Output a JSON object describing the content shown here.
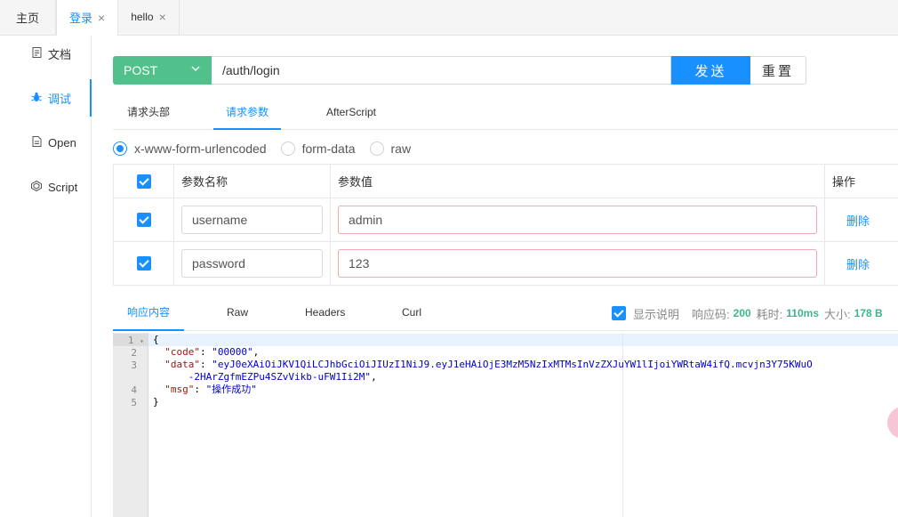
{
  "tabs": {
    "home": "主页",
    "login": "登录",
    "hello": "hello",
    "close": "×"
  },
  "sidebar": {
    "items": [
      {
        "label": "文档",
        "icon": "document-icon"
      },
      {
        "label": "调试",
        "icon": "bug-icon"
      },
      {
        "label": "Open",
        "icon": "file-icon"
      },
      {
        "label": "Script",
        "icon": "code-icon"
      }
    ]
  },
  "request": {
    "method": "POST",
    "url": "/auth/login",
    "send": "发送",
    "reset": "重置"
  },
  "request_tabs": [
    "请求头部",
    "请求参数",
    "AfterScript"
  ],
  "body_types": [
    "x-www-form-urlencoded",
    "form-data",
    "raw"
  ],
  "params": {
    "headers": {
      "name": "参数名称",
      "value": "参数值",
      "action": "操作"
    },
    "rows": [
      {
        "name": "username",
        "value": "admin",
        "action": "删除"
      },
      {
        "name": "password",
        "value": "123",
        "action": "删除"
      }
    ]
  },
  "response_tabs": [
    "响应内容",
    "Raw",
    "Headers",
    "Curl"
  ],
  "response_info": {
    "show_desc": "显示说明",
    "code_label": "响应码:",
    "code": "200",
    "time_label": "耗时:",
    "time": "110ms",
    "size_label": "大小:",
    "size": "178 B"
  },
  "editor": {
    "line_numbers": [
      "1",
      "2",
      "3",
      "",
      "4",
      "5"
    ],
    "lines": {
      "l1": "{",
      "code_key": "\"code\"",
      "code_val": "\"00000\"",
      "data_key": "\"data\"",
      "data_val1": "\"eyJ0eXAiOiJKV1QiLCJhbGciOiJIUzI1NiJ9.eyJ1eHAiOjE3MzM5NzIxMTMsInVzZXJuYW1lIjoiYWRtaW4ifQ.mcvjn3Y75KWuO",
      "data_val2": "-2HArZgfmEZPu4SZvVikb-uFW1Ii2M\"",
      "msg_key": "\"msg\"",
      "msg_val": "\"操作成功\"",
      "l5": "}"
    }
  }
}
